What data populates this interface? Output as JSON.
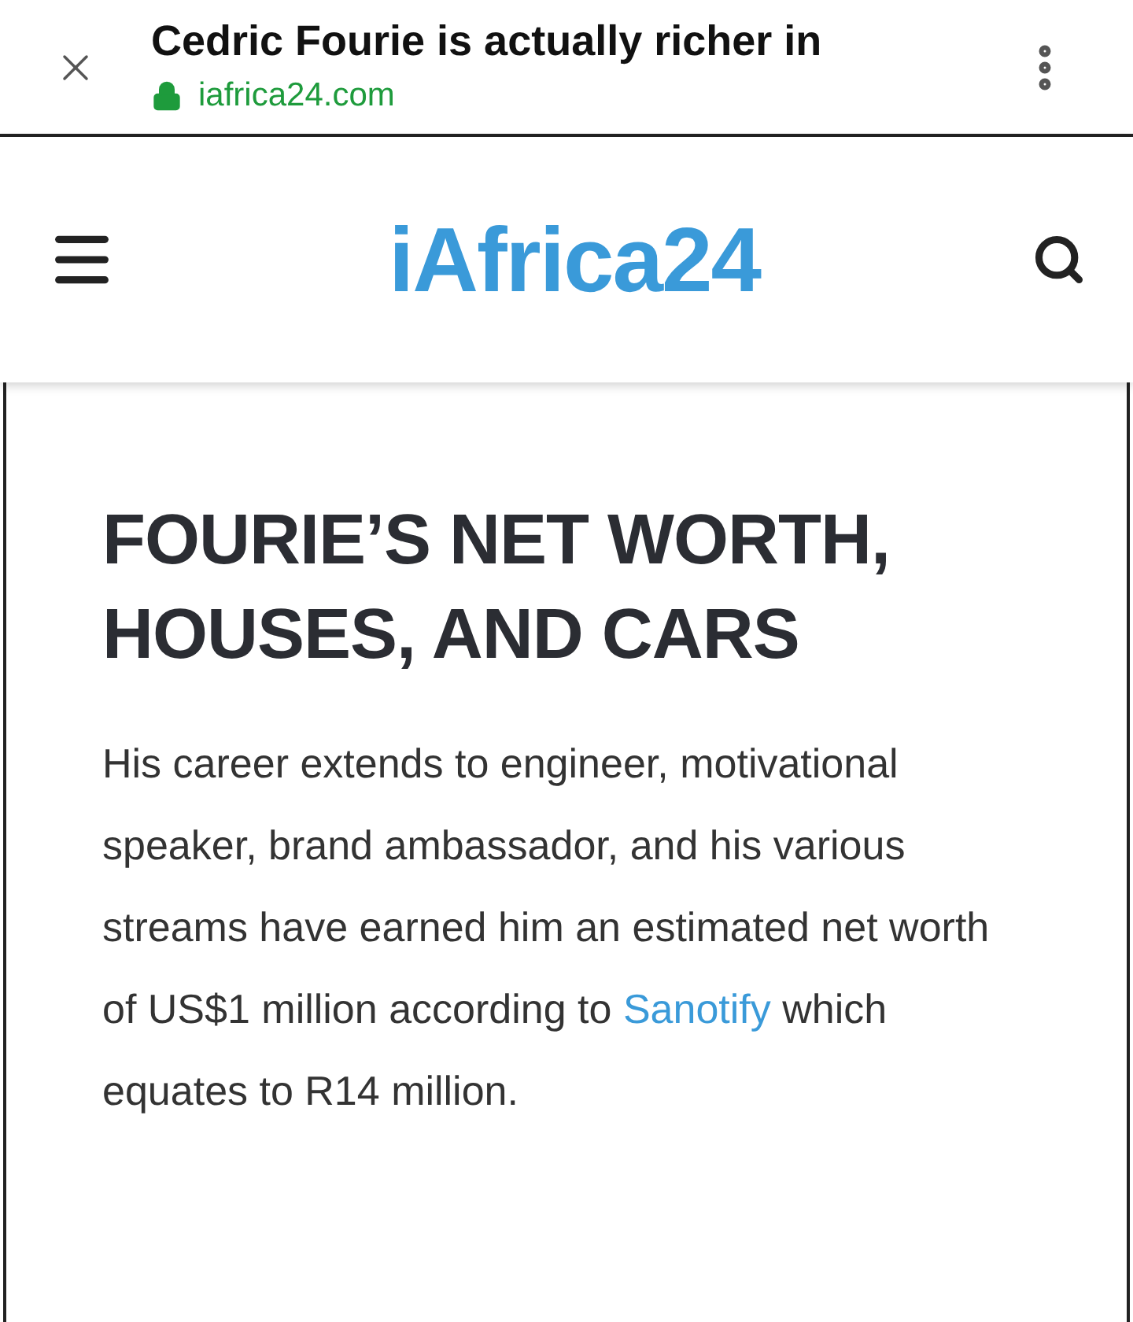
{
  "browser_bar": {
    "title": "Cedric Fourie is actually richer in",
    "url": "iafrica24.com",
    "secure": true
  },
  "site_header": {
    "logo": "iAfrica24"
  },
  "article": {
    "heading": "FOURIE’S NET WORTH, HOUSES, AND CARS",
    "paragraph": {
      "text_before": "His career extends to engineer, motivational speaker, brand ambassador, and his various streams have earned him an estimated net worth of US$1 million according to ",
      "link": "Sanotify",
      "text_after": " which equates to R14 million."
    }
  }
}
